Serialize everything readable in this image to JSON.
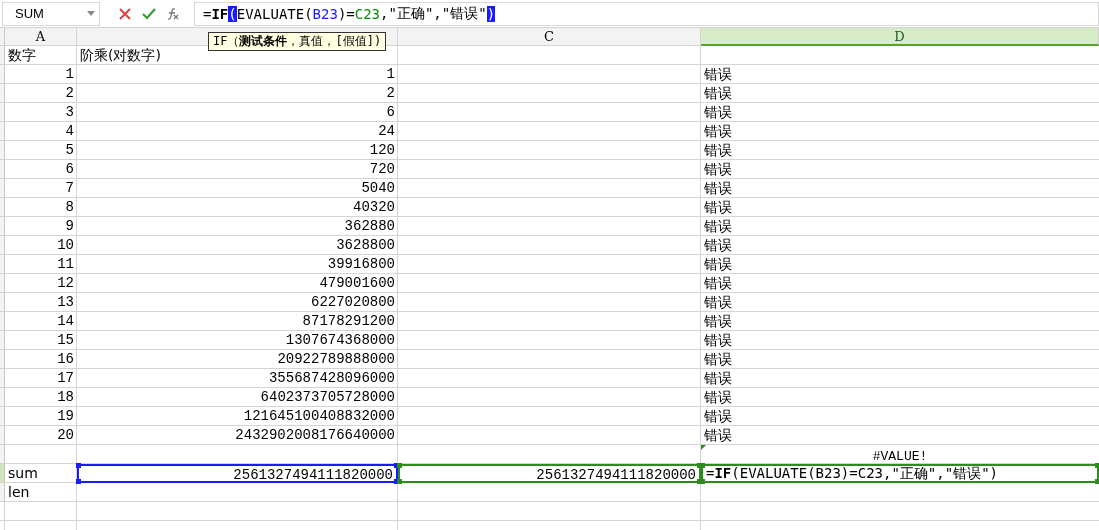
{
  "name_box": {
    "value": "SUM"
  },
  "formula_bar": {
    "segments": [
      {
        "kind": "text",
        "text": "="
      },
      {
        "kind": "bold",
        "text": "IF"
      },
      {
        "kind": "bracket",
        "text": "("
      },
      {
        "kind": "text",
        "text": "EVALUATE("
      },
      {
        "kind": "ref",
        "text": "B23",
        "color": "#1a1aff"
      },
      {
        "kind": "text",
        "text": ")="
      },
      {
        "kind": "ref",
        "text": "C23",
        "color": "#0a8a0a"
      },
      {
        "kind": "text",
        "text": ",\"正确\",\"错误\""
      },
      {
        "kind": "bracket",
        "text": ")"
      }
    ]
  },
  "tooltip": "IF（**测试条件**，真值，[假值])",
  "columns": [
    {
      "label": "A",
      "selected": false
    },
    {
      "selected": false
    },
    {
      "label": "C",
      "selected": false
    },
    {
      "label": "D",
      "selected": true
    }
  ],
  "rows": [
    {
      "selected": false,
      "a": {
        "text": "数字",
        "kind": "text"
      },
      "b": {
        "text": "阶乘(对数字)",
        "kind": "text"
      }
    },
    {
      "selected": false,
      "a": {
        "text": "1",
        "kind": "number"
      },
      "b": {
        "text": "1",
        "kind": "number"
      },
      "d": {
        "text": "错误",
        "kind": "text"
      }
    },
    {
      "selected": false,
      "a": {
        "text": "2",
        "kind": "number"
      },
      "b": {
        "text": "2",
        "kind": "number"
      },
      "d": {
        "text": "错误",
        "kind": "text"
      }
    },
    {
      "selected": false,
      "a": {
        "text": "3",
        "kind": "number"
      },
      "b": {
        "text": "6",
        "kind": "number"
      },
      "d": {
        "text": "错误",
        "kind": "text"
      }
    },
    {
      "selected": false,
      "a": {
        "text": "4",
        "kind": "number"
      },
      "b": {
        "text": "24",
        "kind": "number"
      },
      "d": {
        "text": "错误",
        "kind": "text"
      }
    },
    {
      "selected": false,
      "a": {
        "text": "5",
        "kind": "number"
      },
      "b": {
        "text": "120",
        "kind": "number"
      },
      "d": {
        "text": "错误",
        "kind": "text"
      }
    },
    {
      "selected": false,
      "a": {
        "text": "6",
        "kind": "number"
      },
      "b": {
        "text": "720",
        "kind": "number"
      },
      "d": {
        "text": "错误",
        "kind": "text"
      }
    },
    {
      "selected": false,
      "a": {
        "text": "7",
        "kind": "number"
      },
      "b": {
        "text": "5040",
        "kind": "number"
      },
      "d": {
        "text": "错误",
        "kind": "text"
      }
    },
    {
      "selected": false,
      "a": {
        "text": "8",
        "kind": "number"
      },
      "b": {
        "text": "40320",
        "kind": "number"
      },
      "d": {
        "text": "错误",
        "kind": "text"
      }
    },
    {
      "selected": false,
      "a": {
        "text": "9",
        "kind": "number"
      },
      "b": {
        "text": "362880",
        "kind": "number"
      },
      "d": {
        "text": "错误",
        "kind": "text"
      }
    },
    {
      "selected": false,
      "a": {
        "text": "10",
        "kind": "number"
      },
      "b": {
        "text": "3628800",
        "kind": "number"
      },
      "d": {
        "text": "错误",
        "kind": "text"
      }
    },
    {
      "selected": false,
      "a": {
        "text": "11",
        "kind": "number"
      },
      "b": {
        "text": "39916800",
        "kind": "number"
      },
      "d": {
        "text": "错误",
        "kind": "text"
      }
    },
    {
      "selected": false,
      "a": {
        "text": "12",
        "kind": "number"
      },
      "b": {
        "text": "479001600",
        "kind": "number"
      },
      "d": {
        "text": "错误",
        "kind": "text"
      }
    },
    {
      "selected": false,
      "a": {
        "text": "13",
        "kind": "number"
      },
      "b": {
        "text": "6227020800",
        "kind": "number"
      },
      "d": {
        "text": "错误",
        "kind": "text"
      }
    },
    {
      "selected": false,
      "a": {
        "text": "14",
        "kind": "number"
      },
      "b": {
        "text": "87178291200",
        "kind": "number"
      },
      "d": {
        "text": "错误",
        "kind": "text"
      }
    },
    {
      "selected": false,
      "a": {
        "text": "15",
        "kind": "number"
      },
      "b": {
        "text": "1307674368000",
        "kind": "number"
      },
      "d": {
        "text": "错误",
        "kind": "text"
      }
    },
    {
      "selected": false,
      "a": {
        "text": "16",
        "kind": "number"
      },
      "b": {
        "text": "20922789888000",
        "kind": "number"
      },
      "d": {
        "text": "错误",
        "kind": "text"
      }
    },
    {
      "selected": false,
      "a": {
        "text": "17",
        "kind": "number"
      },
      "b": {
        "text": "355687428096000",
        "kind": "number"
      },
      "d": {
        "text": "错误",
        "kind": "text"
      }
    },
    {
      "selected": false,
      "a": {
        "text": "18",
        "kind": "number"
      },
      "b": {
        "text": "6402373705728000",
        "kind": "number"
      },
      "d": {
        "text": "错误",
        "kind": "text"
      }
    },
    {
      "selected": false,
      "a": {
        "text": "19",
        "kind": "number"
      },
      "b": {
        "text": "121645100408832000",
        "kind": "number"
      },
      "d": {
        "text": "错误",
        "kind": "text"
      }
    },
    {
      "selected": false,
      "a": {
        "text": "20",
        "kind": "number"
      },
      "b": {
        "text": "2432902008176640000",
        "kind": "number"
      },
      "d": {
        "text": "错误",
        "kind": "text"
      }
    },
    {
      "selected": false,
      "d": {
        "text": "#VALUE!",
        "kind": "error",
        "flag": true
      }
    },
    {
      "selected": true,
      "a": {
        "text": "sum",
        "kind": "text"
      },
      "b": {
        "text": "2561327494111820000",
        "kind": "number",
        "color": "#1a1aff"
      },
      "c": {
        "text": "2561327494111820000",
        "kind": "number",
        "color": "#2e8b1e"
      },
      "d": {
        "text": "=**IF**(EVALUATE(B23)=C23,\"正确\",\"错误\")",
        "kind": "editing",
        "color": "#2e8b1e"
      }
    },
    {
      "selected": false,
      "a": {
        "text": "len",
        "kind": "text"
      }
    }
  ]
}
